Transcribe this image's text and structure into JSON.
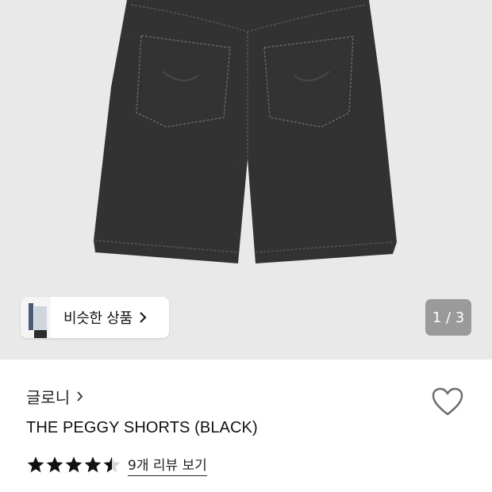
{
  "gallery": {
    "similar_products_label": "비슷한 상품",
    "page_counter": "1 / 3",
    "icons": {
      "similar_chevron": "chevron-right-icon"
    }
  },
  "product": {
    "brand": "글로니",
    "title": "THE PEGGY SHORTS (BLACK)",
    "rating": 4.5,
    "rating_max": 5,
    "review_link": "9개 리뷰 보기",
    "icons": {
      "brand_chevron": "chevron-right-icon",
      "wishlist": "heart-outline-icon",
      "rating": "star-icon"
    }
  },
  "colors": {
    "gallery_bg": "#e9e9e9",
    "counter_bg": "#9a9a9a",
    "star": "#111111"
  }
}
